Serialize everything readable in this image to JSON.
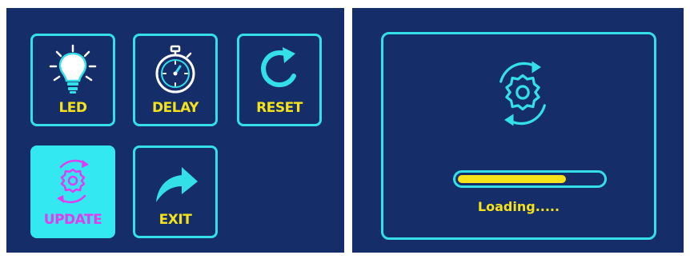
{
  "menu": {
    "tiles": [
      {
        "label": "LED",
        "icon": "light-bulb-icon"
      },
      {
        "label": "DELAY",
        "icon": "stopwatch-icon"
      },
      {
        "label": "RESET",
        "icon": "reset-arrow-icon"
      },
      {
        "label": "UPDATE",
        "icon": "update-gear-icon",
        "selected": true
      },
      {
        "label": "EXIT",
        "icon": "exit-arrow-icon"
      }
    ]
  },
  "loading": {
    "icon": "update-gear-icon",
    "progress_percent": 75,
    "text": "Loading....."
  },
  "colors": {
    "background": "#152e6a",
    "accent": "#34e0e8",
    "label": "#f5e21a",
    "selected_background": "#34e8f2",
    "selected_label": "#e03cf0"
  }
}
